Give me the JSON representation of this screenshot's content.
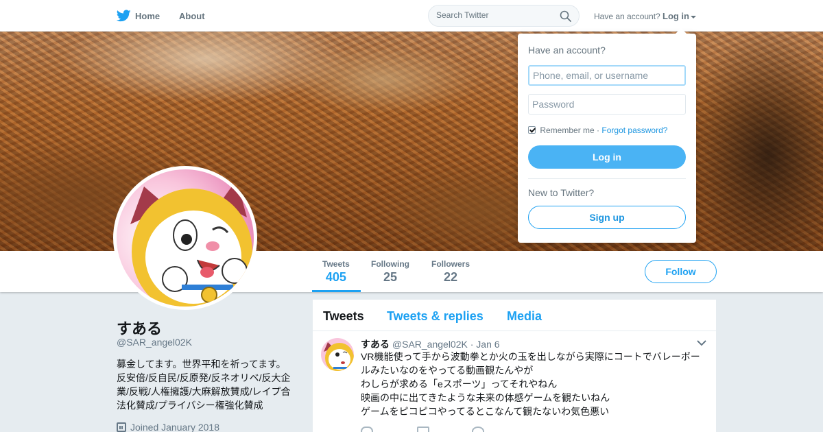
{
  "nav": {
    "home_label": "Home",
    "about_label": "About",
    "search_placeholder": "Search Twitter",
    "have_account_label": "Have an account?",
    "login_label": "Log in",
    "brand_icon": "twitter-bird-icon",
    "search_icon": "magnifier-icon"
  },
  "profile": {
    "display_name": "すある",
    "handle": "@SAR_angel02K",
    "bio": "募金してます。世界平和を祈ってます。反安倍/反自民/反原発/反ネオリベ/反大企業/反戦/人権擁護/大麻解放賛成/レイプ合法化賛成/プライバシー権強化賛成",
    "joined": "Joined January 2018",
    "stats": [
      {
        "label": "Tweets",
        "value": "405"
      },
      {
        "label": "Following",
        "value": "25"
      },
      {
        "label": "Followers",
        "value": "22"
      }
    ],
    "follow_label": "Follow"
  },
  "timeline": {
    "tabs": [
      "Tweets",
      "Tweets & replies",
      "Media"
    ],
    "tweet": {
      "name": "すある",
      "handle": "@SAR_angel02K",
      "dot": "·",
      "date": "Jan 6",
      "lines": [
        "VR機能使って手から波動拳とか火の玉を出しながら実際にコートでバレーボールみたいなのをやってる動画観たんやが",
        "わしらが求める「eスポーツ」ってそれやねん",
        "映画の中に出てきたような未来の体感ゲームを観たいねん",
        "ゲームをピコピコやってるとこなんて観たないわ気色悪い"
      ]
    }
  },
  "login_dropdown": {
    "heading": "Have an account?",
    "username_placeholder": "Phone, email, or username",
    "password_placeholder": "Password",
    "remember_label": "Remember me",
    "separator": "·",
    "forgot_label": "Forgot password?",
    "login_button": "Log in",
    "new_label": "New to Twitter?",
    "signup_button": "Sign up"
  },
  "colors": {
    "accent": "#1da1f2",
    "login_button_bg": "#4ab3f4",
    "page_bg": "#e6ecf0"
  }
}
